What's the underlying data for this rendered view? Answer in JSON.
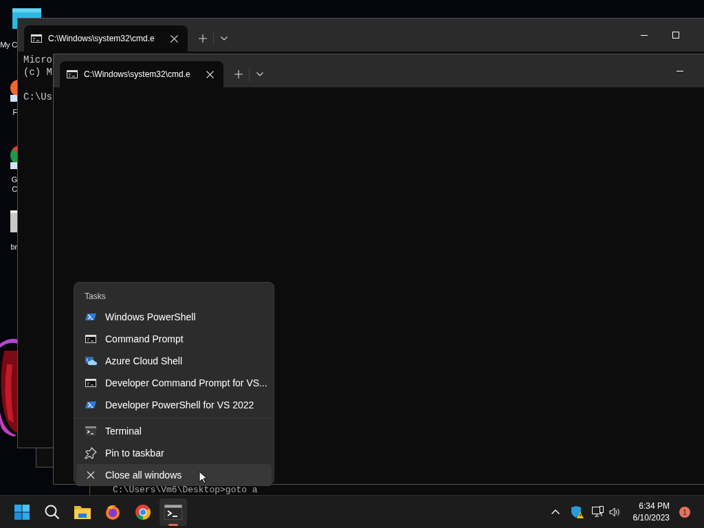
{
  "desktop": {
    "icons": [
      {
        "kind": "monitor",
        "lines": [
          "My C"
        ]
      },
      {
        "kind": "fox",
        "lines": [
          "F"
        ]
      },
      {
        "kind": "round",
        "lines": [
          "G",
          "C"
        ]
      },
      {
        "kind": "file",
        "lines": [
          "br"
        ]
      }
    ]
  },
  "windows": [
    {
      "tab": {
        "title": "C:\\Windows\\system32\\cmd.e"
      },
      "controls": [
        {
          "kind": "minimize"
        },
        {
          "kind": "maximize"
        }
      ],
      "paragraphs": [
        [
          "Micro",
          "(c) M"
        ],
        [
          "C:\\Us"
        ]
      ]
    },
    {
      "tab": {
        "title": "C:\\Windows\\system32\\cmd.e"
      },
      "controls": [
        {
          "kind": "minimize"
        }
      ]
    }
  ],
  "back_console": {
    "text": "C:\\Users\\Vm6\\Desktop>goto a"
  },
  "jump_list": {
    "sections": [
      {
        "title": "Tasks",
        "items": [
          {
            "kind": "powershell",
            "label": "Windows PowerShell",
            "hovered": false
          },
          {
            "kind": "cmd",
            "label": "Command Prompt",
            "hovered": false
          },
          {
            "kind": "cloudshell",
            "label": "Azure Cloud Shell",
            "hovered": false
          },
          {
            "kind": "cmd",
            "label": "Developer Command Prompt for VS...",
            "hovered": false
          },
          {
            "kind": "powershell",
            "label": "Developer PowerShell for VS 2022",
            "hovered": false
          }
        ]
      },
      {
        "items": [
          {
            "kind": "terminal",
            "label": "Terminal",
            "hovered": false
          },
          {
            "kind": "pin",
            "label": "Pin to taskbar",
            "hovered": false
          },
          {
            "kind": "close",
            "label": "Close all windows",
            "hovered": true
          }
        ]
      }
    ]
  },
  "taskbar": {
    "apps": [
      {
        "kind": "start",
        "active": false
      },
      {
        "kind": "search",
        "active": false
      },
      {
        "kind": "folder",
        "active": false
      },
      {
        "kind": "fox",
        "active": false
      },
      {
        "kind": "round",
        "active": false
      },
      {
        "kind": "terminal",
        "active": true
      }
    ],
    "clock": {
      "time": "6:34 PM",
      "date": "6/10/2023"
    },
    "notification_count": "1"
  }
}
